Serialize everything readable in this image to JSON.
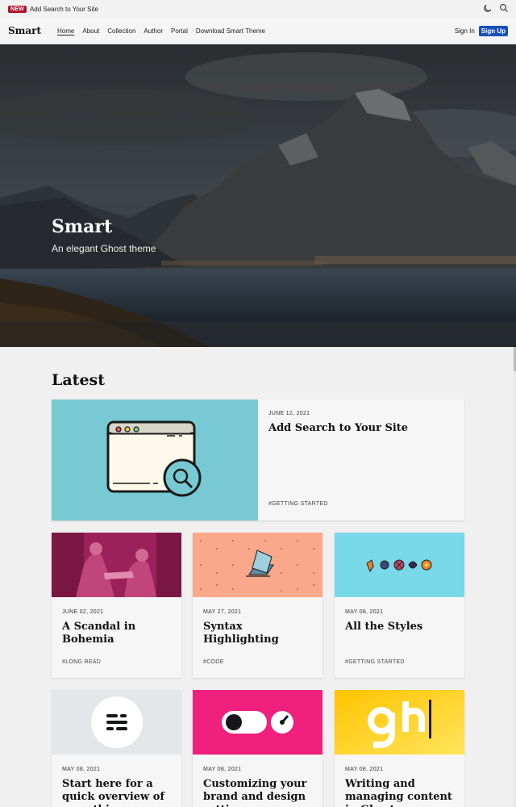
{
  "announcement": {
    "badge": "NEW",
    "text": "Add Search to Your Site"
  },
  "top_icons": [
    "moon-icon",
    "search-icon"
  ],
  "nav": {
    "brand": "Smart",
    "items": [
      "Home",
      "About",
      "Collection",
      "Author",
      "Portal",
      "Download Smart Theme"
    ],
    "signin": "Sign In",
    "signup": "Sign Up"
  },
  "hero": {
    "title": "Smart",
    "subtitle": "An elegant Ghost theme"
  },
  "section_title": "Latest",
  "featured": {
    "date": "JUNE 12, 2021",
    "title": "Add Search to Your Site",
    "tag": "#GETTING STARTED"
  },
  "posts": [
    {
      "date": "JUNE 02, 2021",
      "title": "A Scandal in Bohemia",
      "tag": "#LONG READ"
    },
    {
      "date": "MAY 27, 2021",
      "title": "Syntax Highlighting",
      "tag": "#CODE"
    },
    {
      "date": "MAY 08, 2021",
      "title": "All the Styles",
      "tag": "#GETTING STARTED"
    },
    {
      "date": "MAY 08, 2021",
      "title": "Start here for a quick overview of everything you need"
    },
    {
      "date": "MAY 08, 2021",
      "title": "Customizing your brand and design settings"
    },
    {
      "date": "MAY 08, 2021",
      "title": "Writing and managing content in Ghost, an advanced guide"
    }
  ],
  "colors": {
    "accent": "#1a4fb5",
    "badge": "#b3122e",
    "featured_bg": "#77cad3"
  }
}
